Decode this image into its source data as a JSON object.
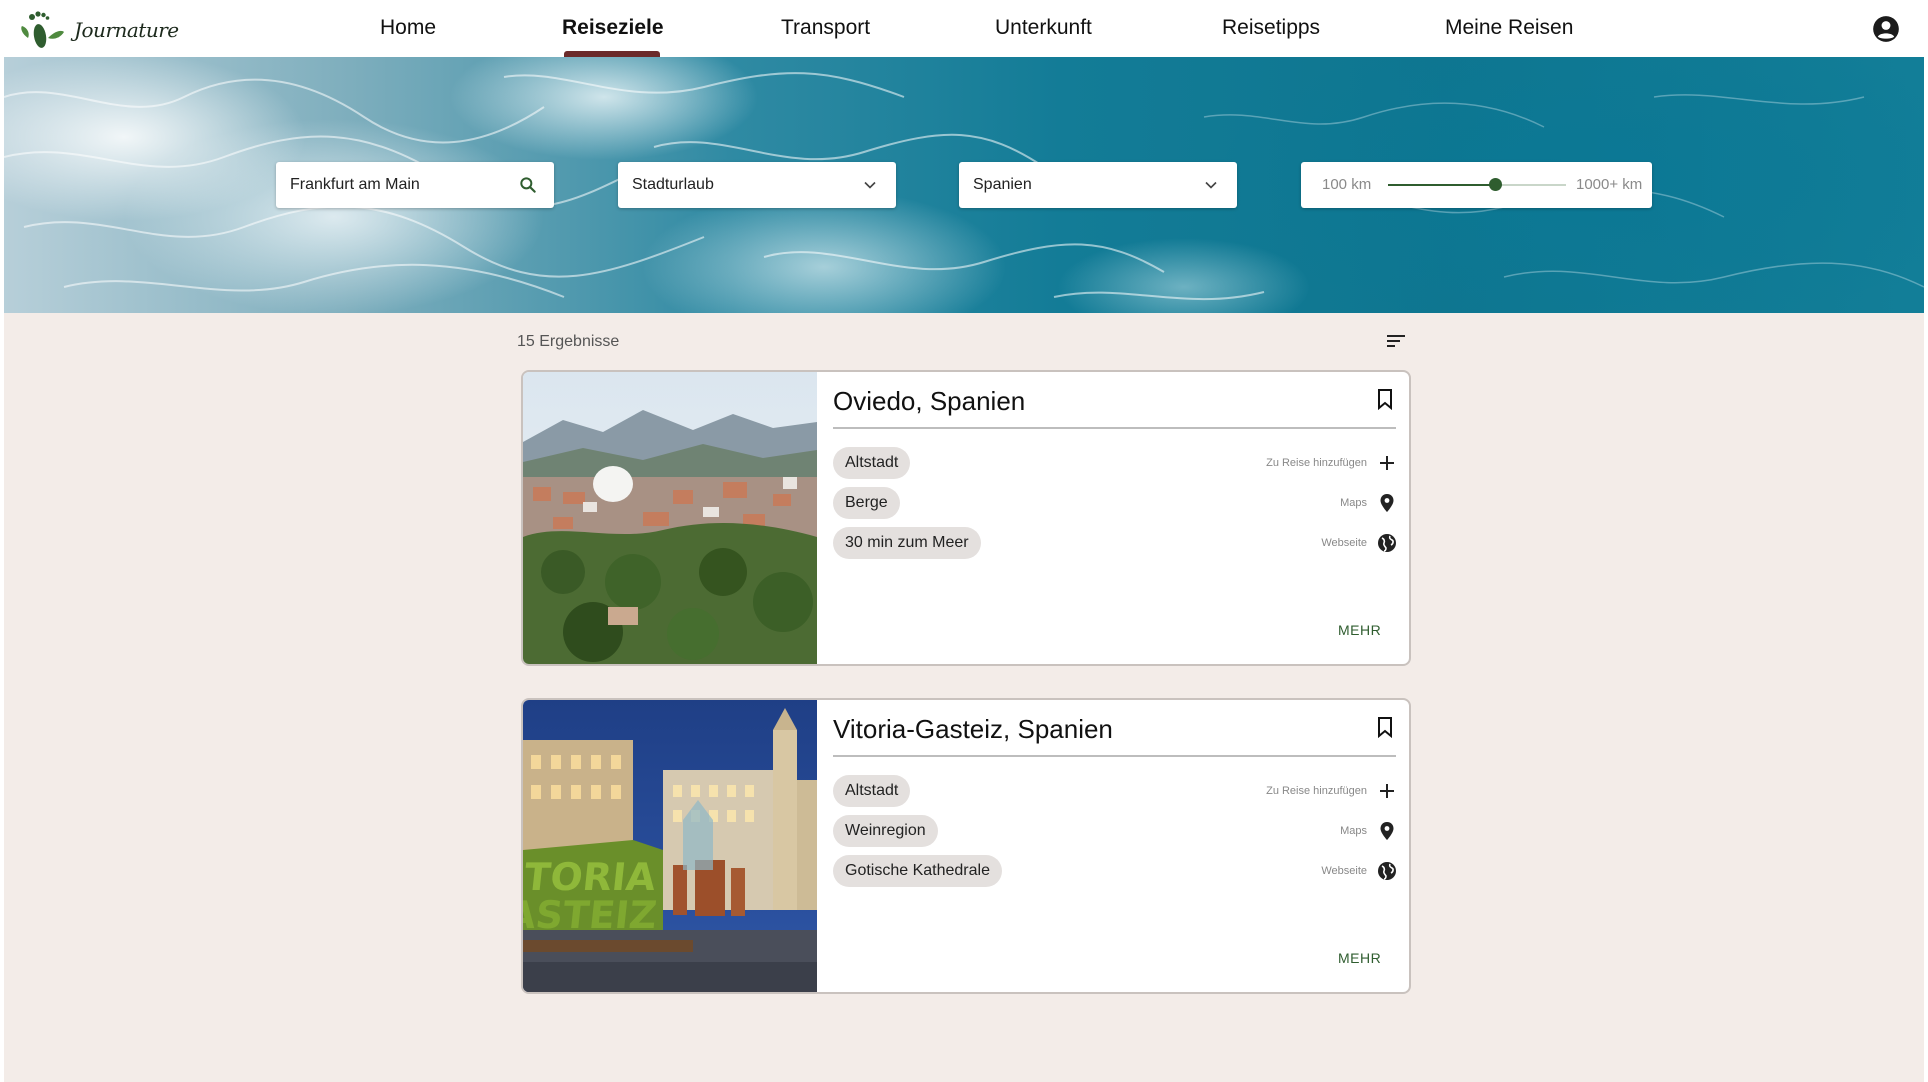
{
  "brand": {
    "name": "Journature",
    "accent": "#2f5d2f"
  },
  "nav": {
    "items": [
      {
        "label": "Home",
        "active": false
      },
      {
        "label": "Reiseziele",
        "active": true
      },
      {
        "label": "Transport",
        "active": false
      },
      {
        "label": "Unterkunft",
        "active": false
      },
      {
        "label": "Reisetipps",
        "active": false
      },
      {
        "label": "Meine Reisen",
        "active": false
      }
    ],
    "account_icon": "account-circle-icon"
  },
  "filters": {
    "origin": {
      "value": "Frankfurt am Main",
      "icon": "search-icon"
    },
    "type": {
      "value": "Stadturlaub",
      "icon": "chevron-down-icon"
    },
    "country": {
      "value": "Spanien",
      "icon": "chevron-down-icon"
    },
    "distance": {
      "min_label": "100 km",
      "max_label": "1000+ km",
      "value_fraction": 0.6
    }
  },
  "results": {
    "count_label": "15 Ergebnisse",
    "sort_icon": "sort-icon",
    "cards": [
      {
        "title": "Oviedo, Spanien",
        "tags": [
          "Altstadt",
          "Berge",
          "30 min zum Meer"
        ],
        "actions": [
          {
            "label": "Zu Reise hinzufügen",
            "icon": "plus-icon"
          },
          {
            "label": "Maps",
            "icon": "map-pin-icon"
          },
          {
            "label": "Webseite",
            "icon": "globe-icon"
          }
        ],
        "more_label": "MEHR"
      },
      {
        "title": "Vitoria-Gasteiz, Spanien",
        "tags": [
          "Altstadt",
          "Weinregion",
          "Gotische Kathedrale"
        ],
        "actions": [
          {
            "label": "Zu Reise hinzufügen",
            "icon": "plus-icon"
          },
          {
            "label": "Maps",
            "icon": "map-pin-icon"
          },
          {
            "label": "Webseite",
            "icon": "globe-icon"
          }
        ],
        "more_label": "MEHR"
      }
    ]
  }
}
